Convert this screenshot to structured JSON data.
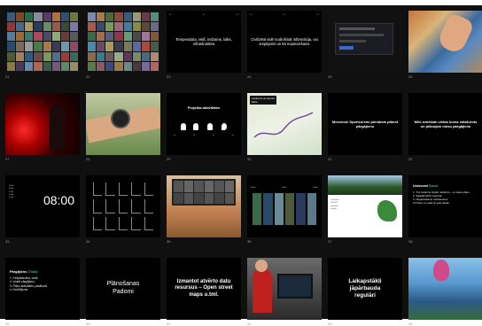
{
  "colors": {
    "background": "#101010",
    "slide": "#000000",
    "green_highlight": "#4caf50",
    "red_highlight": "#ff4040"
  },
  "slides": {
    "s3": {
      "text": "Temperatūra, vējš, redzams, laiks, infrastruktūra"
    },
    "s4": {
      "text": "Civilizētā vidē nodrošināt informācija, vai iespējams un kā nepieciešams"
    },
    "s9": {
      "title": "Projekta aktivitātes"
    },
    "s10": {
      "label": "Laukums un sporta karte"
    },
    "s11": {
      "text": "Mezonos! Sponsoreas pieraksts plānot pārgājienu"
    },
    "s12": {
      "text": "Mēs izmēšam vietas kuras raksturots un plānojam mūsu pārgājienu"
    },
    "s13": {
      "clock": "08:00"
    },
    "s18": {
      "title": "Uzdevumi",
      "title_highlight": "Stand",
      "items": [
        "1. Trīs vispirms izpētīt maršrutu – uz karte plāno",
        "2. Sastādi GPS maršrutu",
        "3. Nepieciešams nobrauciens",
        "Uzziniet, ko veikt ar soļu skaitu"
      ]
    },
    "s19": {
      "title": "Pārgājiens",
      "title_highlight": "(Tāda)",
      "items": [
        "1. Pašpārliecība, vietā",
        "2. Izlodē pārgājienu",
        "3. Plāno aktivitātes, pasākumi",
        "4. Novēlējums"
      ]
    },
    "s20": {
      "line1": "Plānošanas",
      "line2": "Padomi"
    },
    "s21": {
      "text": "Izmantot atvērto datu resursus – Open street maps u.tml."
    },
    "s23": {
      "line1": "Laikapstākļi",
      "line2": "jāpārbauda",
      "line3": "regulāri"
    }
  },
  "slide_numbers": [
    "21",
    "22",
    "23",
    "24",
    "25",
    "26",
    "27",
    "28",
    "29",
    "30",
    "31",
    "32",
    "33",
    "34",
    "35",
    "36",
    "37",
    "38",
    "39",
    "40",
    "41",
    "42",
    "43",
    "44"
  ]
}
